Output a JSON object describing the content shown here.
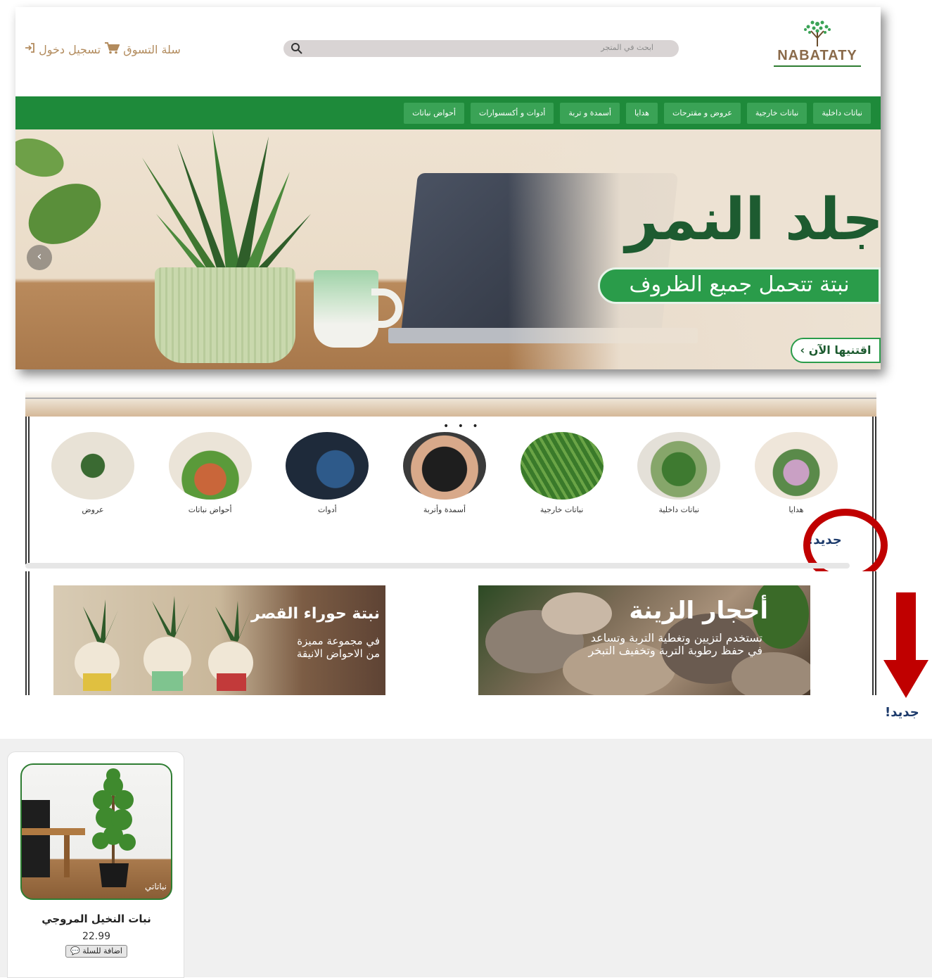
{
  "header": {
    "logo_text": "NABATATY",
    "search_placeholder": "ابحث في المتجر",
    "cart_label": "سلة التسوق",
    "login_label": "تسجيل دخول"
  },
  "nav": {
    "items": [
      "نباتات داخلية",
      "نباتات خارجية",
      "عروض و مقترحات",
      "هدايا",
      "أسمدة و تربة",
      "أدوات و أكسسوارات",
      "أحواض نباتات"
    ]
  },
  "hero": {
    "title": "جلد النمر",
    "tagline": "نبتة تتحمل جميع الظروف",
    "cta": "اقتنيها الآن ›",
    "prev_arrow": "‹"
  },
  "categories": {
    "dots": "• • •",
    "items": [
      {
        "label": "هدايا"
      },
      {
        "label": "نباتات داخلية"
      },
      {
        "label": "نباتات خارجية"
      },
      {
        "label": "أسمدة وأتربة"
      },
      {
        "label": "أدوات"
      },
      {
        "label": "أحواض نباتات"
      },
      {
        "label": "عروض"
      }
    ]
  },
  "new_label": "جديد!",
  "banners": [
    {
      "title": "نبتة حوراء القصر",
      "line1": "في مجموعة مميزة",
      "line2": "من الاحواض الانيقة"
    },
    {
      "title": "أحجار الزينة",
      "line1": "تستخدم لتزيين وتغطية التربة وتساعد",
      "line2": "في حفظ رطوبة التربة وتخفيف التبخر"
    }
  ],
  "annotation": {
    "new_label": "جديد!",
    "ring_color": "#c00000",
    "arrow_color": "#c00000"
  },
  "product": {
    "name": "نبات النخيل المروجي",
    "price": "22.99",
    "add_to_cart": "اضافة للسلة",
    "watermark": "نباتاتي"
  },
  "colors": {
    "nav_bg": "#1e8a3a",
    "nav_item": "#3aa356",
    "brand_brown": "#b28b5d",
    "title_green": "#1d5b30"
  }
}
